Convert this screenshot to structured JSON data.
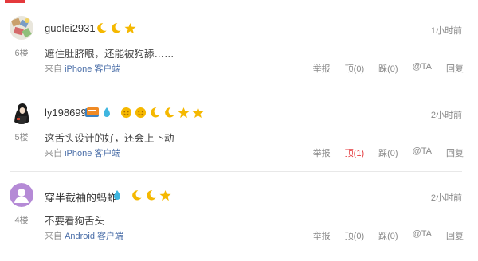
{
  "comments": [
    {
      "username": "guolei2931",
      "floor": "6楼",
      "time": "1小时前",
      "text": "遮住肚脐眼，还能被狗舔……",
      "source_prefix": "来自",
      "client": "iPhone 客户端",
      "badges": [
        "moon-icon",
        "moon-icon",
        "star-icon"
      ],
      "actions": {
        "report": "举报",
        "up": "顶(0)",
        "down": "踩(0)",
        "at": "@TA",
        "reply": "回复"
      }
    },
    {
      "username": "ly198699",
      "floor": "5楼",
      "time": "2小时前",
      "text": "这舌头设计的好，还会上下动",
      "source_prefix": "来自",
      "client": "iPhone 客户端",
      "badges": [
        "member-card-icon",
        "water-drop-icon",
        "sun-icon",
        "sun-icon",
        "moon-icon",
        "moon-icon",
        "star-icon",
        "star-icon"
      ],
      "actions": {
        "report": "举报",
        "up": "顶(1)",
        "down": "踩(0)",
        "at": "@TA",
        "reply": "回复"
      }
    },
    {
      "username": "穿半截袖的蚂蚱",
      "floor": "4楼",
      "time": "2小时前",
      "text": "不要看狗舌头",
      "source_prefix": "来自",
      "client": "Android 客户端",
      "badges": [
        "water-drop-icon",
        "moon-icon",
        "moon-icon",
        "star-icon"
      ],
      "actions": {
        "report": "举报",
        "up": "顶(0)",
        "down": "踩(0)",
        "at": "@TA",
        "reply": "回复"
      }
    }
  ],
  "colors": {
    "accent": "#e4393c",
    "link": "#4a6ea8",
    "muted": "#8a8a8a",
    "badge_gold": "#f5b800",
    "avatar_default": "#b58ad6"
  }
}
